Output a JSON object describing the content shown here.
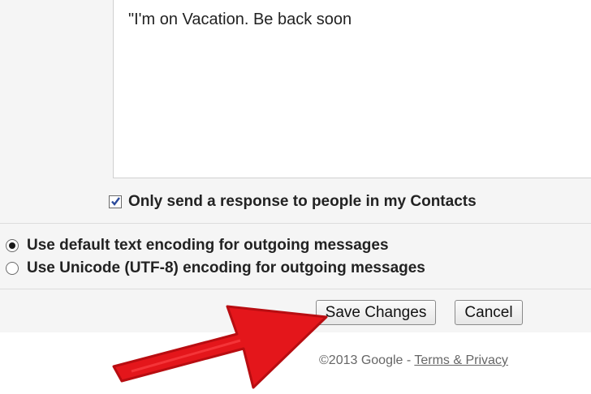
{
  "vacation": {
    "message_body": "\"I'm on Vacation. Be back soon",
    "contacts_only_label": "Only send a response to people in my Contacts",
    "contacts_only_checked": true
  },
  "encoding": {
    "options": [
      {
        "label": "Use default text encoding for outgoing messages",
        "selected": true
      },
      {
        "label": "Use Unicode (UTF-8) encoding for outgoing messages",
        "selected": false
      }
    ]
  },
  "actions": {
    "save_label": "Save Changes",
    "cancel_label": "Cancel"
  },
  "footer": {
    "copyright": "©2013 Google - ",
    "terms_link": "Terms & Privacy"
  },
  "overlay": {
    "arrow_icon": "red-arrow-icon",
    "arrow_color": "#e4161b"
  }
}
